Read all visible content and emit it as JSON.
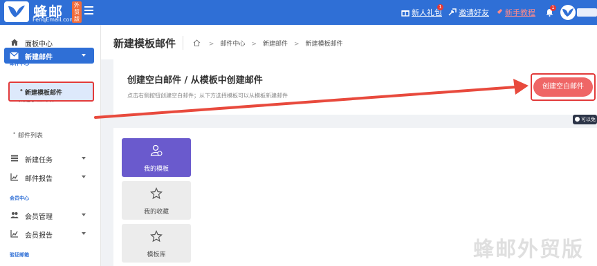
{
  "brand": {
    "name": "蜂邮",
    "domain": "FenqEmail.com",
    "tag": "外贸版"
  },
  "topbar": {
    "gift_label": "新人礼包",
    "gift_badge": "1",
    "invite_label": "邀请好友",
    "guide_label": "新手教程",
    "notify_badge": "1"
  },
  "sidebar": {
    "dashboard": "面板中心",
    "section_mail": "邮件中心",
    "new_mail": "新建邮件",
    "sub_manual": "新建手工邮件",
    "sub_template": "新建模板邮件",
    "sub_list": "邮件列表",
    "new_task": "新建任务",
    "mail_report": "邮件报告",
    "section_member": "会员中心",
    "member_manage": "会员管理",
    "member_report": "会员报告",
    "section_verify": "验证邮箱"
  },
  "header": {
    "title": "新建模板邮件",
    "breadcrumb": [
      "邮件中心",
      "新建邮件",
      "新建模板邮件"
    ]
  },
  "create": {
    "title": "创建空白邮件 / 从模板中创建邮件",
    "hint": "点击右侧按钮创建空白邮件；从下方选择模板可以从模板新建邮件",
    "button": "创建空白邮件",
    "side_chip": "可以免"
  },
  "tiles": [
    "我的模板",
    "我的收藏",
    "模板库"
  ],
  "watermark": "蜂邮外贸版",
  "colors": {
    "primary": "#2f6fd6",
    "accent": "#ef6666",
    "tile_active": "#6a5acd",
    "highlight": "#e23a3a"
  }
}
